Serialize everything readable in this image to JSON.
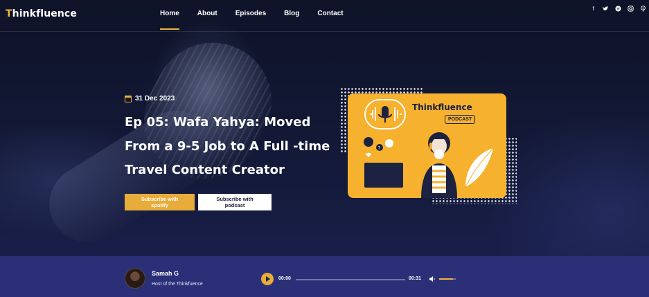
{
  "header": {
    "logo_main": "Thinkfluen",
    "logo_o": "c",
    "logo_end": "e",
    "logo_accent_letter": "T",
    "nav": [
      {
        "label": "Home",
        "active": true
      },
      {
        "label": "About",
        "active": false
      },
      {
        "label": "Episodes",
        "active": false
      },
      {
        "label": "Blog",
        "active": false
      },
      {
        "label": "Contact",
        "active": false
      }
    ],
    "social_icons": [
      "facebook-icon",
      "twitter-icon",
      "spotify-icon",
      "instagram-icon",
      "podcast-icon"
    ]
  },
  "hero": {
    "date": "31 Dec 2023",
    "title": "Ep 05: Wafa Yahya: Moved From a 9-5 Job to A Full -time Travel Content Creator",
    "buttons": {
      "spotify": "Subscribe with spotify",
      "podcast": "Subscribe with podcast"
    },
    "art": {
      "brand": "Thinkfluence",
      "badge": "PODCAST"
    }
  },
  "player": {
    "host_name": "Samah G",
    "host_role": "Host of the Thinkfuence",
    "current_time": "00:00",
    "duration": "00:31",
    "progress": 0,
    "volume": 0.85
  },
  "colors": {
    "accent": "#f2b33a",
    "background": "#0d1226",
    "player_bar": "#2a2f78"
  }
}
